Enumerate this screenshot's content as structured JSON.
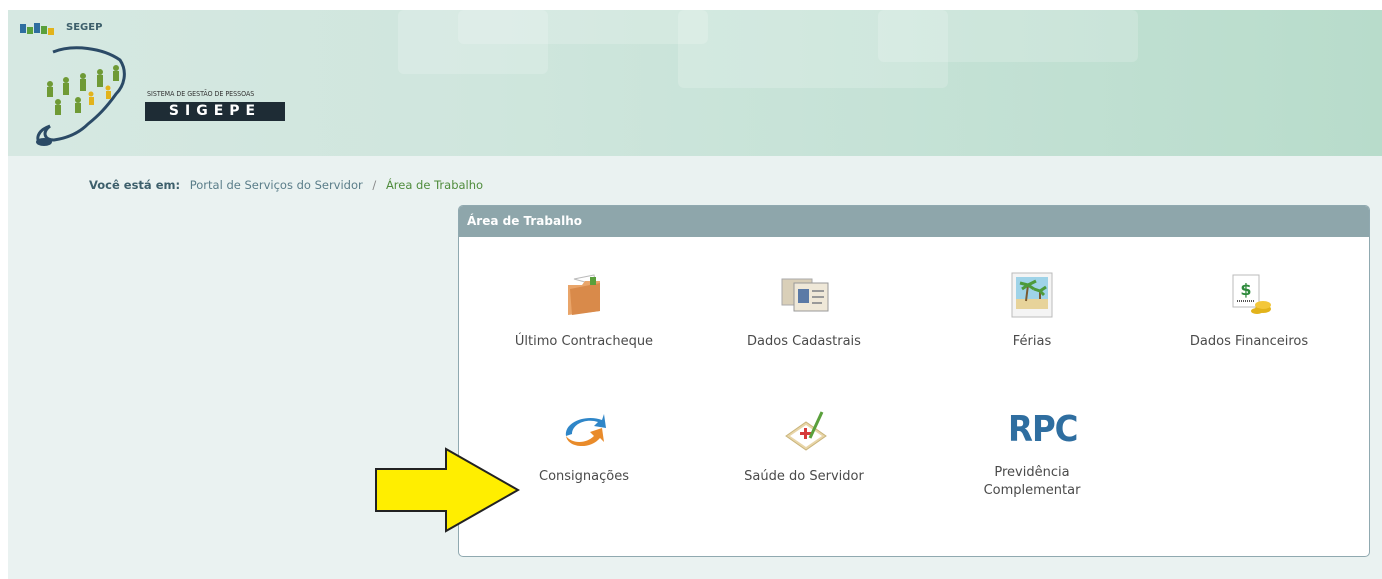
{
  "header": {
    "org": "SEGEP",
    "system_subtitle": "SISTEMA DE GESTÃO DE PESSOAS",
    "system_name": "SIGEPE"
  },
  "breadcrumb": {
    "label": "Você está em:",
    "items": [
      "Portal de Serviços do Servidor",
      "Área de Trabalho"
    ],
    "separator": "/"
  },
  "panel": {
    "title": "Área de Trabalho",
    "tiles": [
      {
        "label": "Último Contracheque",
        "icon": "folder-icon"
      },
      {
        "label": "Dados Cadastrais",
        "icon": "id-cards-icon"
      },
      {
        "label": "Férias",
        "icon": "beach-photo-icon"
      },
      {
        "label": "Dados Financeiros",
        "icon": "money-icon"
      },
      {
        "label": "Consignações",
        "icon": "refresh-arrow-icon"
      },
      {
        "label": "Saúde do Servidor",
        "icon": "medical-clipboard-icon"
      },
      {
        "label": "Previdência Complementar",
        "icon": "rpc-logo",
        "icon_text": "RPC"
      }
    ]
  },
  "annotation": {
    "icon": "yellow-arrow-icon",
    "color": "#ffee00"
  }
}
